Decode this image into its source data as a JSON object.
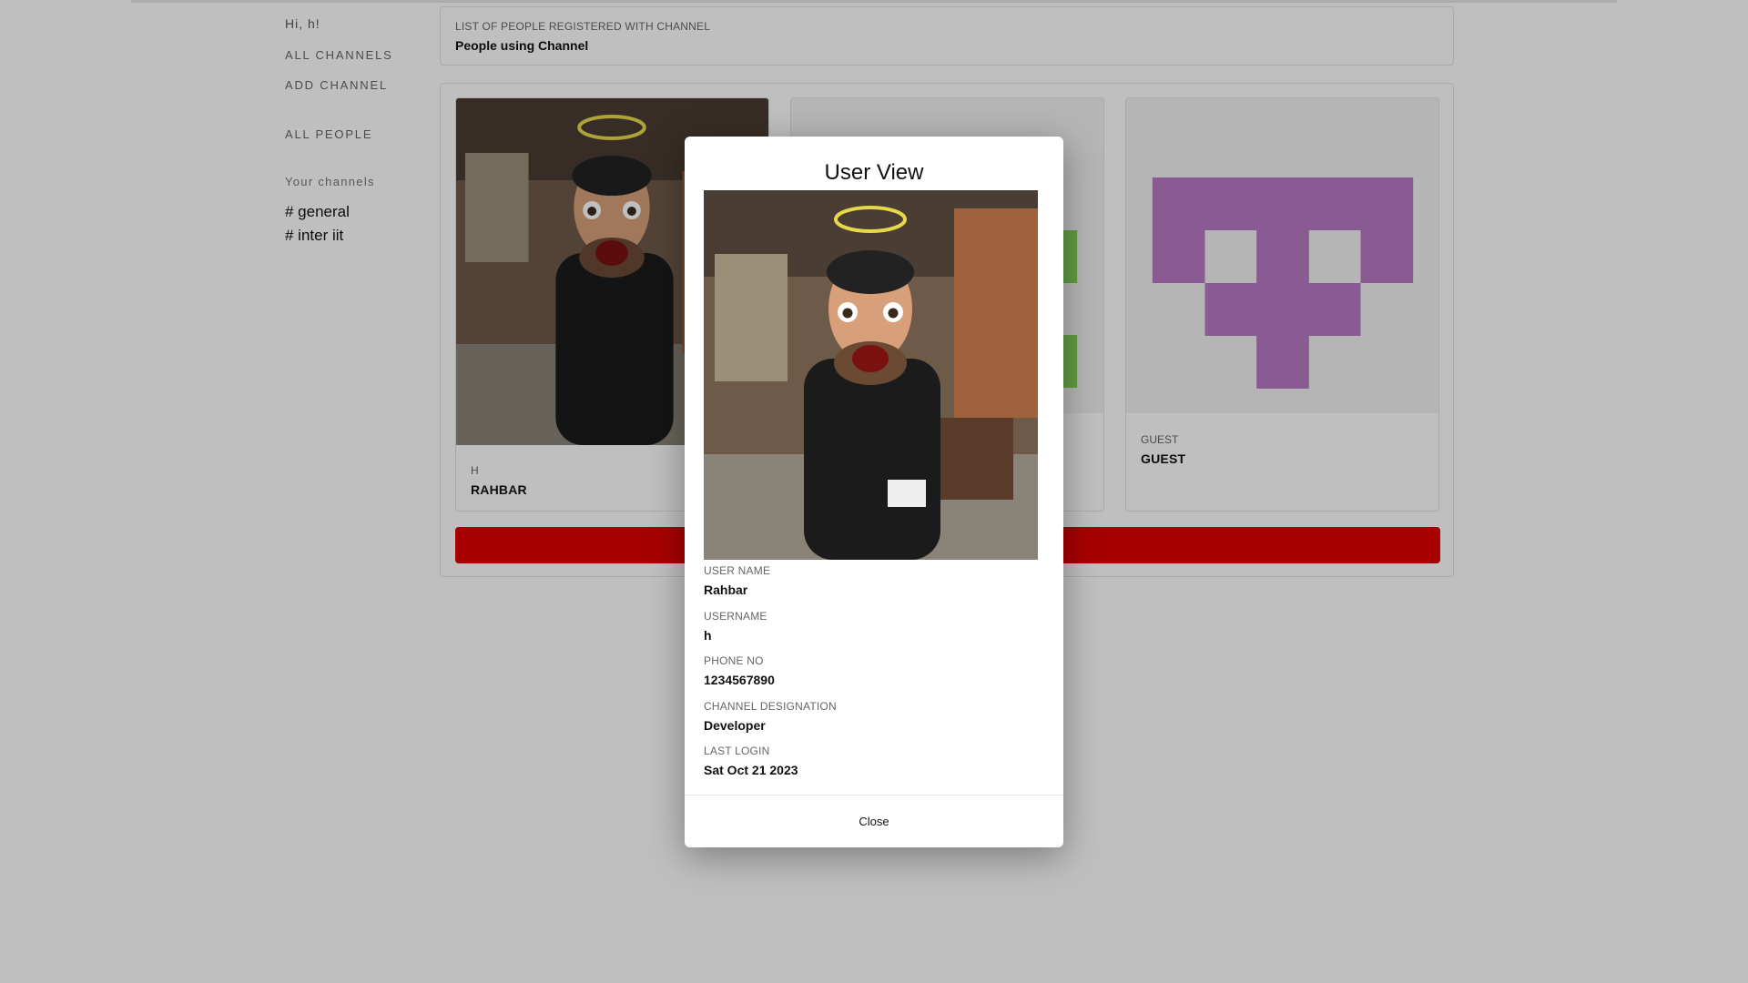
{
  "sidebar": {
    "greeting": "Hi, h!",
    "links": [
      "ALL CHANNELS",
      "ADD CHANNEL",
      "ALL PEOPLE"
    ],
    "section_title": "Your channels",
    "channels": [
      "# general",
      "# inter iit"
    ]
  },
  "header": {
    "caption": "LIST OF PEOPLE REGISTERED WITH CHANNEL",
    "title": "People using Channel"
  },
  "people": [
    {
      "username": "H",
      "name": "RAHBAR"
    },
    {
      "username": "",
      "name": ""
    },
    {
      "username": "GUEST",
      "name": "GUEST"
    }
  ],
  "colors": {
    "danger": "#e00000",
    "identicon_green": "#82cf5a",
    "identicon_purple": "#b879c4"
  },
  "modal": {
    "title": "User View",
    "fields": [
      {
        "label": "USER NAME",
        "value": "Rahbar"
      },
      {
        "label": "USERNAME",
        "value": "h"
      },
      {
        "label": "PHONE NO",
        "value": "1234567890"
      },
      {
        "label": "CHANNEL DESIGNATION",
        "value": "Developer"
      },
      {
        "label": "LAST LOGIN",
        "value": "Sat Oct 21 2023"
      }
    ],
    "close_label": "Close"
  }
}
